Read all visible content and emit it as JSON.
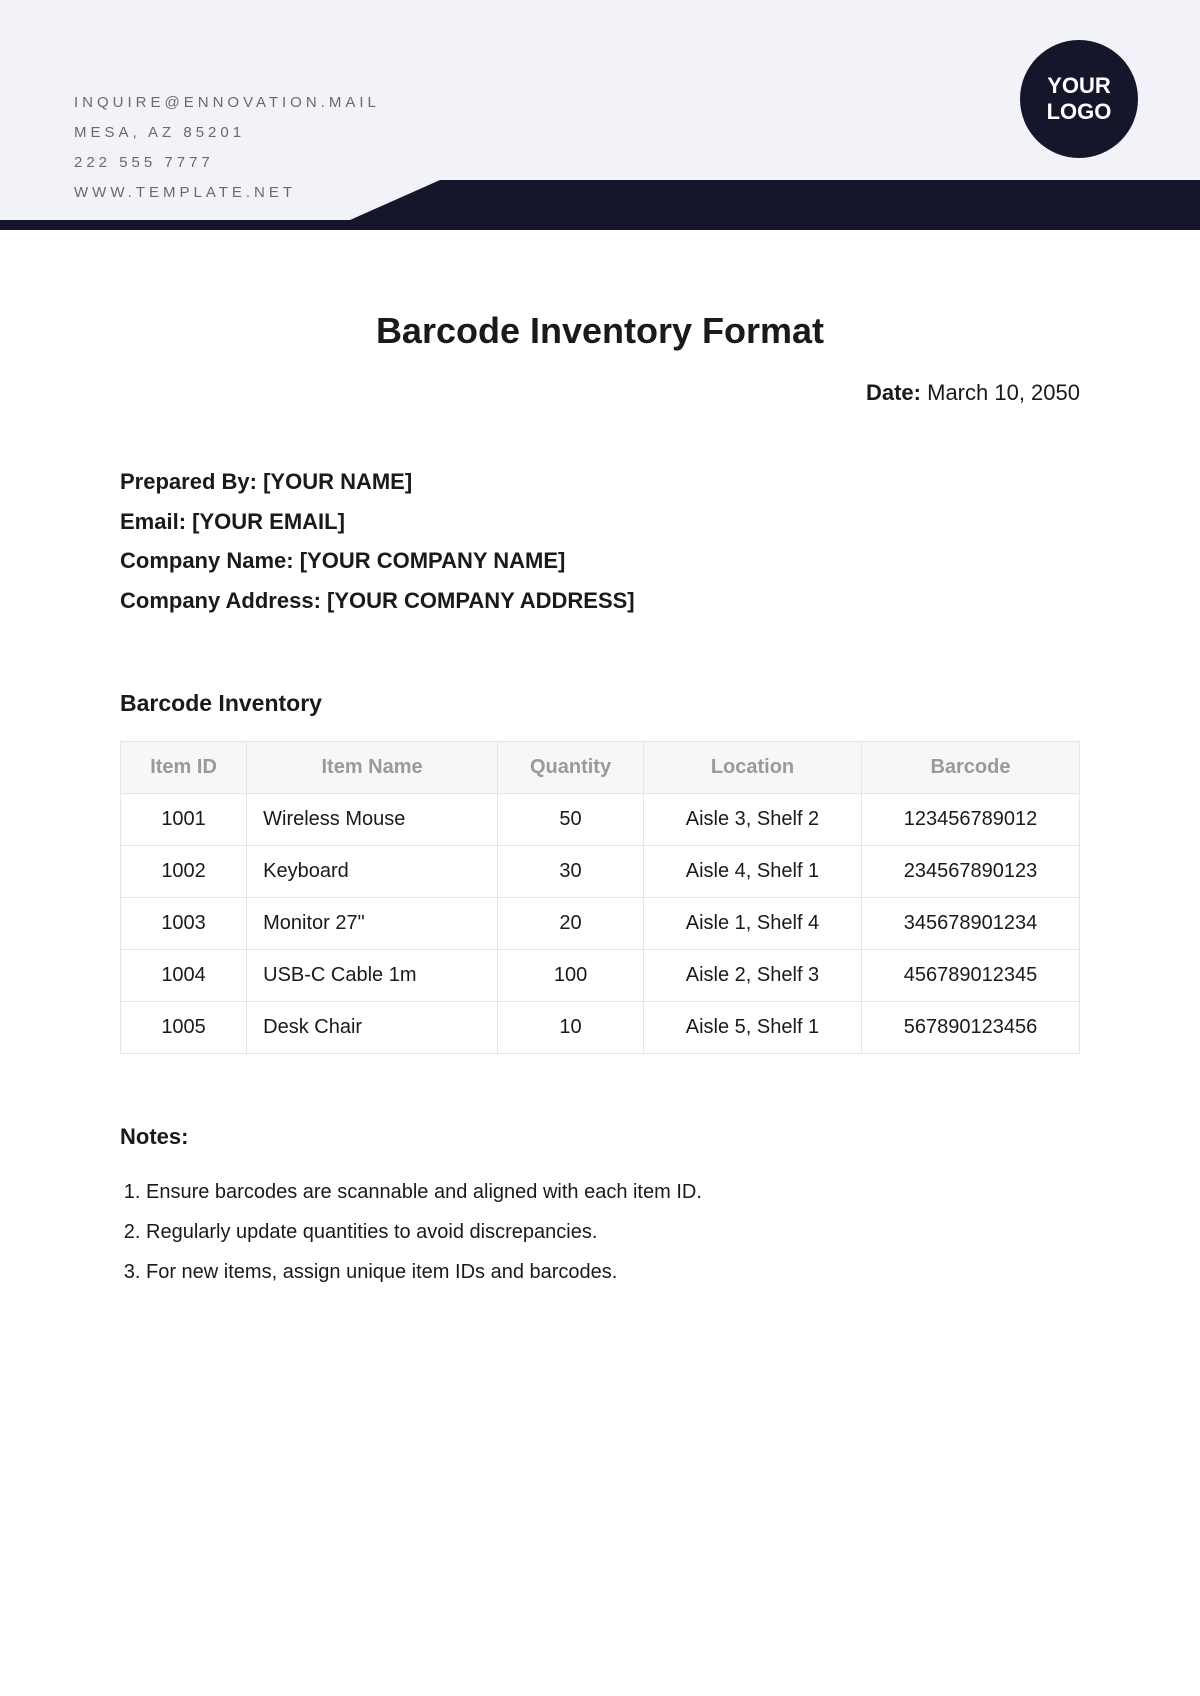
{
  "contact": {
    "email": "INQUIRE@ENNOVATION.MAIL",
    "city": "MESA, AZ 85201",
    "phone": "222 555 7777",
    "web": "WWW.TEMPLATE.NET"
  },
  "logo": {
    "line1": "YOUR",
    "line2": "LOGO"
  },
  "title": "Barcode Inventory Format",
  "date_label": "Date:",
  "date_value": "March 10, 2050",
  "info": {
    "prepared_by_label": "Prepared By:",
    "prepared_by_value": "[YOUR NAME]",
    "email_label": "Email:",
    "email_value": "[YOUR EMAIL]",
    "company_label": "Company Name:",
    "company_value": "[YOUR COMPANY NAME]",
    "address_label": "Company Address:",
    "address_value": "[YOUR COMPANY ADDRESS]"
  },
  "section_heading": "Barcode Inventory",
  "table": {
    "headers": {
      "id": "Item ID",
      "name": "Item Name",
      "qty": "Quantity",
      "loc": "Location",
      "bc": "Barcode"
    },
    "rows": [
      {
        "id": "1001",
        "name": "Wireless Mouse",
        "qty": "50",
        "loc": "Aisle 3, Shelf 2",
        "bc": "123456789012"
      },
      {
        "id": "1002",
        "name": "Keyboard",
        "qty": "30",
        "loc": "Aisle 4, Shelf 1",
        "bc": "234567890123"
      },
      {
        "id": "1003",
        "name": "Monitor 27\"",
        "qty": "20",
        "loc": "Aisle 1, Shelf 4",
        "bc": "345678901234"
      },
      {
        "id": "1004",
        "name": "USB-C Cable 1m",
        "qty": "100",
        "loc": "Aisle 2, Shelf 3",
        "bc": "456789012345"
      },
      {
        "id": "1005",
        "name": "Desk Chair",
        "qty": "10",
        "loc": "Aisle 5, Shelf 1",
        "bc": "567890123456"
      }
    ]
  },
  "notes_heading": "Notes:",
  "notes": [
    "Ensure barcodes are scannable and aligned with each item ID.",
    "Regularly update quantities to avoid discrepancies.",
    "For new items, assign unique item IDs and barcodes."
  ]
}
